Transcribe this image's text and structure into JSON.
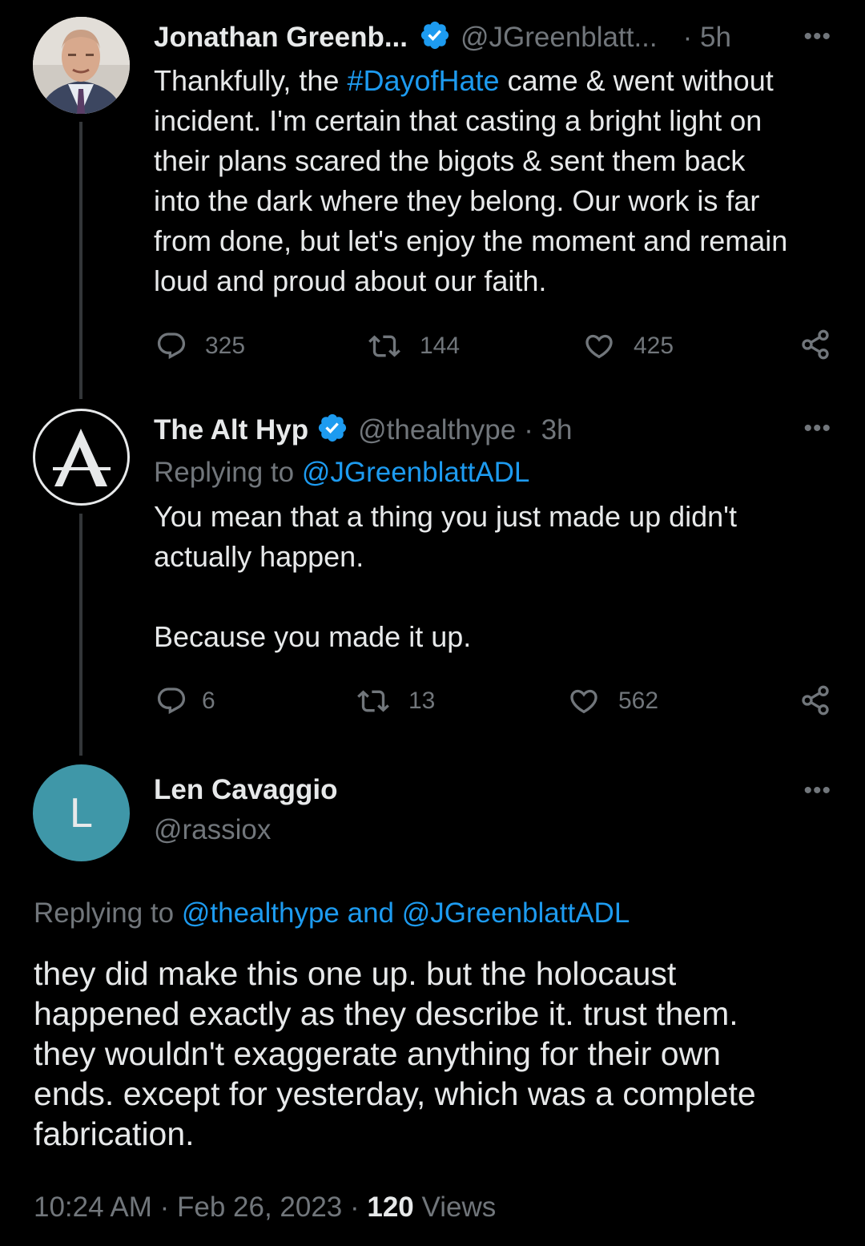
{
  "tweets": [
    {
      "display_name": "Jonathan Greenb...",
      "handle": "@JGreenblatt...",
      "time": "· 5h",
      "text_before": "Thankfully, the ",
      "hashtag": "#DayofHate",
      "text_after": " came & went without\nincident. I'm certain that casting a bright light on\ntheir plans scared the bigots & sent them back\ninto the dark where they belong. Our work is far\nfrom done, but let's enjoy the moment and remain\nloud and proud about our faith.",
      "replies": "325",
      "retweets": "144",
      "likes": "425"
    },
    {
      "display_name": "The Alt Hyp",
      "handle": "@thealthype",
      "time": "· 3h",
      "replying_label": "Replying to",
      "replying_handle": "@JGreenblattADL",
      "text": "You mean that a thing you just made up didn't\nactually happen.\n\nBecause you made it up.",
      "replies": "6",
      "retweets": "13",
      "likes": "562"
    }
  ],
  "main_tweet": {
    "avatar_letter": "L",
    "display_name": "Len Cavaggio",
    "handle": "@rassiox",
    "replying_label": "Replying to",
    "replying_handles": "@thealthype and @JGreenblattADL",
    "text": "they did make this one up. but the holocaust\nhappened exactly as they describe it. trust them.\nthey wouldn't exaggerate anything for their own\nends. except for yesterday, which was a complete\nfabrication.",
    "timestamp": "10:24 AM · Feb 26, 2023 · ",
    "views_count": "120",
    "views_label": " Views"
  },
  "more_icon": "•••",
  "colors": {
    "background": "#000000",
    "text": "#e7e9ea",
    "secondary": "#71767b",
    "accent": "#1d9bf0",
    "avatar_teal": "#3f97a8"
  }
}
